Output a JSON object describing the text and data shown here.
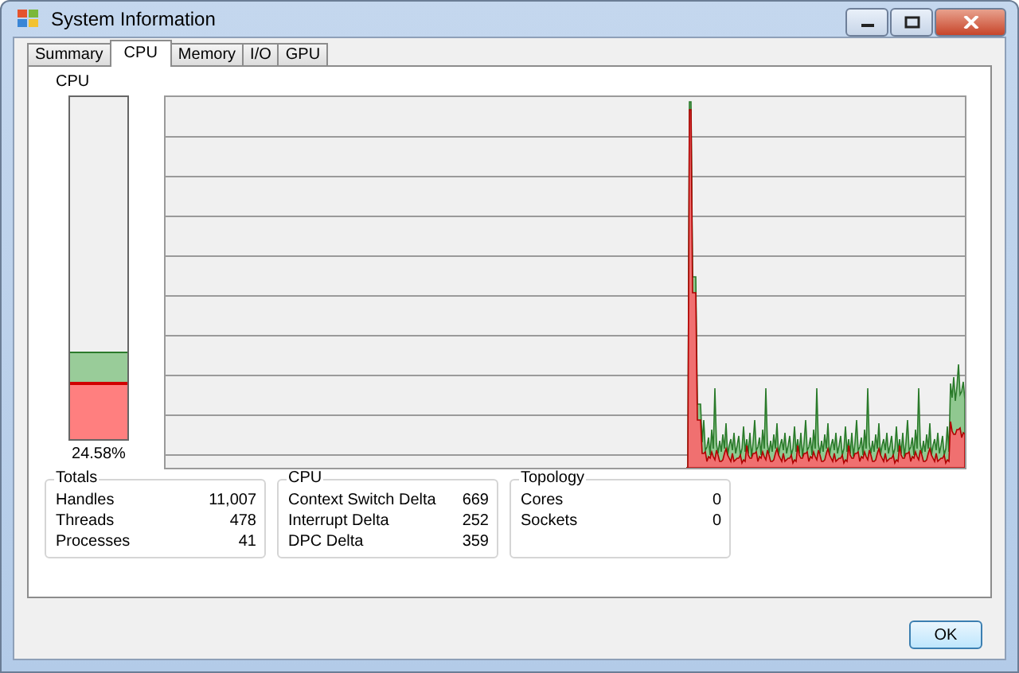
{
  "window": {
    "title": "System Information"
  },
  "tabs": [
    {
      "label": "Summary",
      "selected": false
    },
    {
      "label": "CPU",
      "selected": true
    },
    {
      "label": "Memory",
      "selected": false
    },
    {
      "label": "I/O",
      "selected": false
    },
    {
      "label": "GPU",
      "selected": false
    }
  ],
  "cpu_meter": {
    "label": "CPU",
    "bars": [
      {
        "kind": "total",
        "level": 0.25
      },
      {
        "kind": "kernel",
        "level": 0.16
      }
    ],
    "reading": "24.58%"
  },
  "groups": [
    {
      "title": "Totals",
      "rows": [
        {
          "label": "Handles",
          "value": "11,007"
        },
        {
          "label": "Threads",
          "value": "478"
        },
        {
          "label": "Processes",
          "value": "41"
        }
      ]
    },
    {
      "title": "CPU",
      "rows": [
        {
          "label": "Context Switch Delta",
          "value": "669"
        },
        {
          "label": "Interrupt Delta",
          "value": "252"
        },
        {
          "label": "DPC Delta",
          "value": "359"
        }
      ]
    },
    {
      "title": "Topology",
      "rows": [
        {
          "label": "Cores",
          "value": "0"
        },
        {
          "label": "Sockets",
          "value": "0"
        }
      ]
    }
  ],
  "buttons": [
    "OK"
  ]
}
